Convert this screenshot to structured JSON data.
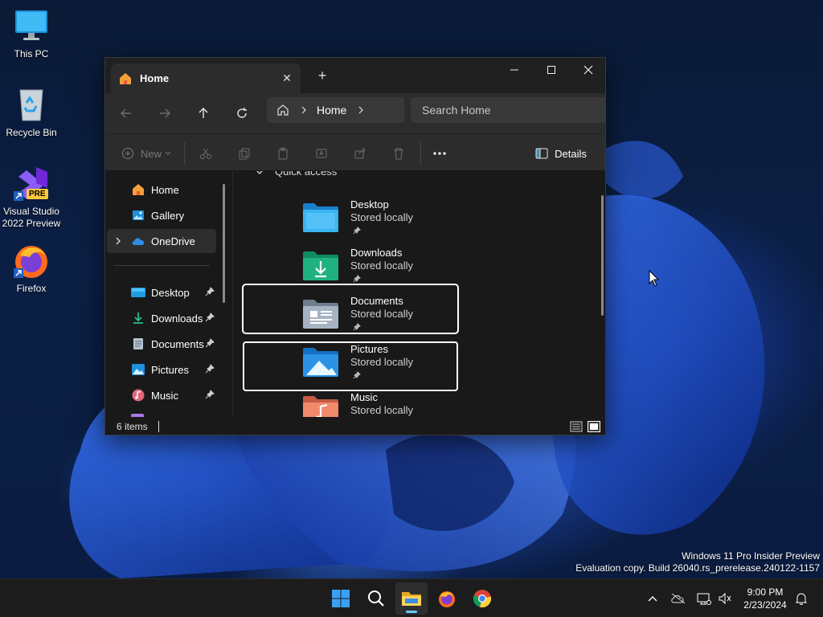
{
  "desktop": {
    "icons": [
      {
        "label": "This PC"
      },
      {
        "label": "Recycle Bin"
      },
      {
        "label": "Visual Studio 2022 Preview",
        "badge": "PRE"
      },
      {
        "label": "Firefox"
      }
    ]
  },
  "explorer": {
    "tab_title": "Home",
    "breadcrumb": "Home",
    "search_placeholder": "Search Home",
    "commands": {
      "new_label": "New",
      "details_label": "Details"
    },
    "nav_pane": {
      "top_items": [
        {
          "label": "Home",
          "icon": "home-icon"
        },
        {
          "label": "Gallery",
          "icon": "gallery-icon"
        },
        {
          "label": "OneDrive",
          "icon": "onedrive-icon",
          "selected": true
        }
      ],
      "pinned_items": [
        {
          "label": "Desktop",
          "icon": "desktop-folder-icon"
        },
        {
          "label": "Downloads",
          "icon": "downloads-folder-icon"
        },
        {
          "label": "Documents",
          "icon": "documents-folder-icon"
        },
        {
          "label": "Pictures",
          "icon": "pictures-folder-icon"
        },
        {
          "label": "Music",
          "icon": "music-folder-icon"
        }
      ]
    },
    "quick_access": {
      "header": "Quick access",
      "items": [
        {
          "name": "Desktop",
          "status": "Stored locally",
          "icon": "desktop-folder-icon"
        },
        {
          "name": "Downloads",
          "status": "Stored locally",
          "icon": "downloads-folder-icon"
        },
        {
          "name": "Documents",
          "status": "Stored locally",
          "icon": "documents-folder-icon",
          "focused": true
        },
        {
          "name": "Pictures",
          "status": "Stored locally",
          "icon": "pictures-folder-icon"
        },
        {
          "name": "Music",
          "status": "Stored locally",
          "icon": "music-folder-icon"
        }
      ]
    },
    "status_text": "6 items"
  },
  "watermark": {
    "line1": "Windows 11 Pro Insider Preview",
    "line2": "Evaluation copy. Build 26040.rs_prerelease.240122-1157"
  },
  "taskbar": {
    "apps": [
      "start-icon",
      "search-icon",
      "file-explorer-icon",
      "firefox-icon",
      "chrome-icon"
    ],
    "clock": {
      "time": "9:00 PM",
      "date": "2/23/2024"
    }
  },
  "colors": {
    "accent": "#60cdff",
    "window_bg": "#191919",
    "toolbar_bg": "#2c2c2c"
  }
}
